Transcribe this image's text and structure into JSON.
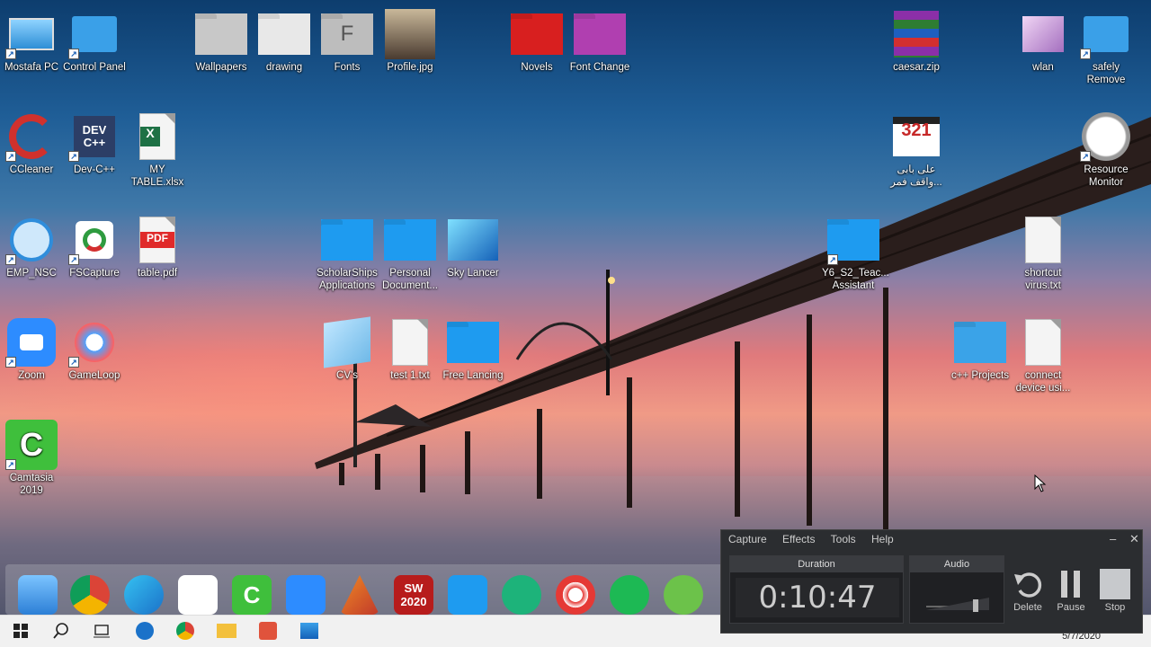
{
  "desktop": {
    "icons": [
      {
        "label": "Mostafa PC"
      },
      {
        "label": "Control Panel"
      },
      {
        "label": "Wallpapers"
      },
      {
        "label": "drawing"
      },
      {
        "label": "Fonts"
      },
      {
        "label": "Profile.jpg"
      },
      {
        "label": "Novels"
      },
      {
        "label": "Font Change"
      },
      {
        "label": "caesar.zip"
      },
      {
        "label": "wlan"
      },
      {
        "label": "safely Remove"
      },
      {
        "label": "CCleaner"
      },
      {
        "label": "Dev-C++"
      },
      {
        "label": "MY TABLE.xlsx"
      },
      {
        "label": "علی بابی واقف فمر..."
      },
      {
        "label": "Resource Monitor"
      },
      {
        "label": "EMP_NSC"
      },
      {
        "label": "FSCapture"
      },
      {
        "label": "table.pdf"
      },
      {
        "label": "ScholarShips Applications"
      },
      {
        "label": "Personal Document..."
      },
      {
        "label": "Sky Lancer"
      },
      {
        "label": "Y6_S2_Teac... Assistant"
      },
      {
        "label": "shortcut virus.txt"
      },
      {
        "label": "Zoom"
      },
      {
        "label": "GameLoop"
      },
      {
        "label": "CV's"
      },
      {
        "label": "test 1.txt"
      },
      {
        "label": "Free Lancing"
      },
      {
        "label": "c++ Projects"
      },
      {
        "label": "connect device usi..."
      },
      {
        "label": "Camtasia 2019"
      }
    ],
    "icon_badges": {
      "dev": "DEV C++",
      "pdf": "PDF",
      "excel": "X",
      "fonts": "F",
      "counter": "321",
      "sw": "SW 2020"
    }
  },
  "recorder": {
    "menu": [
      "Capture",
      "Effects",
      "Tools",
      "Help"
    ],
    "duration_label": "Duration",
    "duration_value": "0:10:47",
    "audio_label": "Audio",
    "delete_label": "Delete",
    "pause_label": "Pause",
    "stop_label": "Stop"
  },
  "taskbar": {
    "date": "5/7/2020"
  }
}
